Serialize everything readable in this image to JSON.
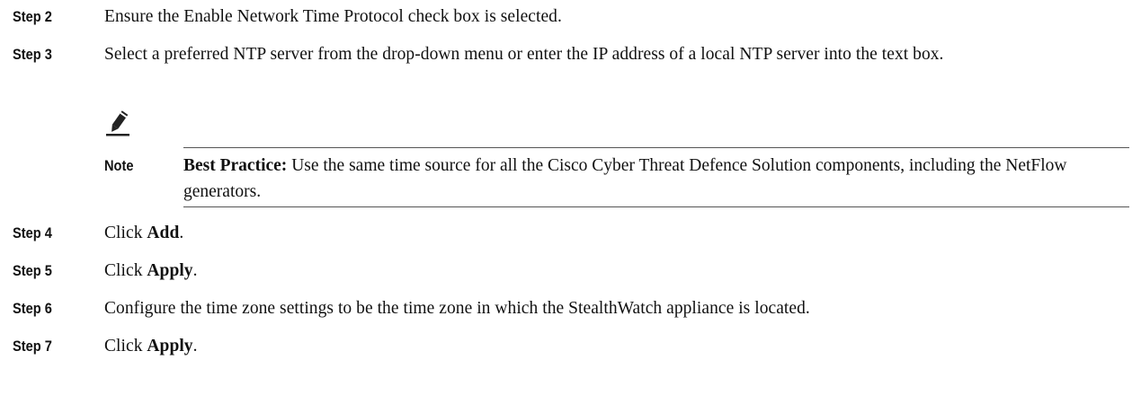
{
  "steps": [
    {
      "label": "Step 2",
      "text": "Ensure the Enable Network Time Protocol check box is selected."
    },
    {
      "label": "Step 3",
      "text": "Select a preferred NTP server from the drop-down menu or enter the IP address of a local NTP server into the text box."
    },
    {
      "label": "Step 4",
      "text_prefix": "Click ",
      "text_bold": "Add",
      "text_suffix": "."
    },
    {
      "label": "Step 5",
      "text_prefix": "Click ",
      "text_bold": "Apply",
      "text_suffix": "."
    },
    {
      "label": "Step 6",
      "text": "Configure the time zone settings to be the time zone in which the StealthWatch appliance is located."
    },
    {
      "label": "Step 7",
      "text_prefix": "Click ",
      "text_bold": "Apply",
      "text_suffix": "."
    }
  ],
  "note": {
    "icon": "pencil-icon",
    "label": "Note",
    "bold_lead": "Best Practice:",
    "text": " Use the same time source for all the Cisco Cyber Threat Defence Solution components, including the NetFlow generators."
  }
}
